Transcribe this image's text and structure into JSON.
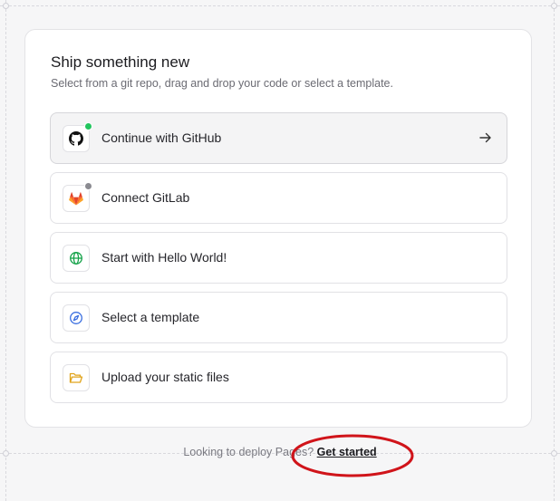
{
  "card": {
    "title": "Ship something new",
    "subtitle": "Select from a git repo, drag and drop your code or select a template."
  },
  "options": [
    {
      "label": "Continue with GitHub",
      "icon": "github-icon",
      "status_color": "#22c55e"
    },
    {
      "label": "Connect GitLab",
      "icon": "gitlab-icon",
      "status_color": "#8a8a90"
    },
    {
      "label": "Start with Hello World!",
      "icon": "globe-icon"
    },
    {
      "label": "Select a template",
      "icon": "compass-icon"
    },
    {
      "label": "Upload your static files",
      "icon": "folder-icon"
    }
  ],
  "footer": {
    "prompt": "Looking to deploy Pages?",
    "link": "Get started"
  },
  "colors": {
    "annotation": "#d0141a",
    "github_dot": "#22c55e",
    "gitlab_dot": "#8a8a90"
  }
}
